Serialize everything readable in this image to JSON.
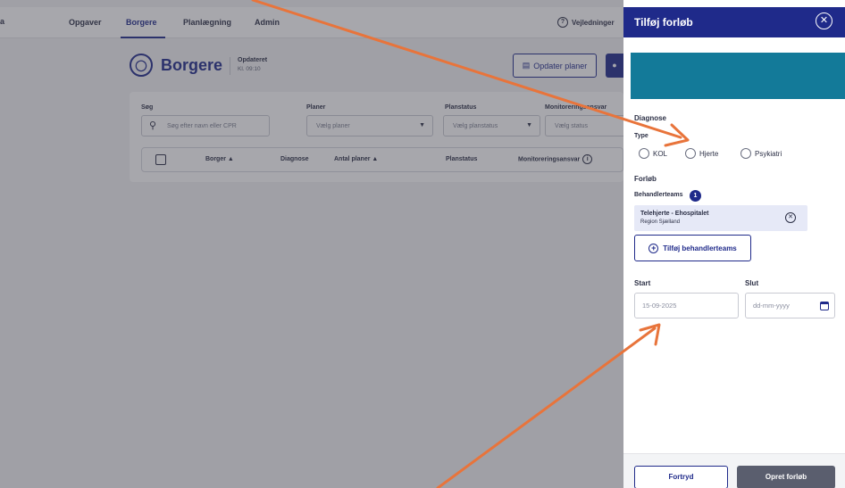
{
  "nav": {
    "edge_label": "a",
    "items": [
      "Opgaver",
      "Borgere",
      "Planlægning",
      "Admin"
    ],
    "help": "Vejledninger"
  },
  "page": {
    "title": "Borgere",
    "updated_label": "Opdateret",
    "updated_time": "Kl. 09:10",
    "update_button": "Opdater planer"
  },
  "filters": {
    "search_label": "Søg",
    "search_placeholder": "Søg efter navn eller CPR",
    "plans_label": "Planer",
    "plans_placeholder": "Vælg planer",
    "planstatus_label": "Planstatus",
    "planstatus_placeholder": "Vælg planstatus",
    "monitoring_label": "Monitoreringsansvar",
    "monitoring_placeholder": "Vælg status"
  },
  "table": {
    "columns": [
      "Borger",
      "Diagnose",
      "Antal planer",
      "Planstatus",
      "Monitoreringsansvar"
    ]
  },
  "panel": {
    "title": "Tilføj forløb",
    "diagnosis_section": "Diagnose",
    "type_label": "Type",
    "type_options": [
      "KOL",
      "Hjerte",
      "Psykiatri"
    ],
    "course_section": "Forløb",
    "teams_label": "Behandlerteams",
    "teams_count": "1",
    "team_name": "Telehjerte - Ehospitalet",
    "team_region": "Region Sjælland",
    "add_team_button": "Tilføj behandlerteams",
    "start_label": "Start",
    "start_value": "15-09-2025",
    "end_label": "Slut",
    "end_placeholder": "dd-mm-yyyy",
    "cancel_button": "Fortryd",
    "create_button": "Opret forløb"
  },
  "colors": {
    "primary": "#1f2a8a",
    "annotation": "#e8743b",
    "redaction": "#137a99"
  }
}
